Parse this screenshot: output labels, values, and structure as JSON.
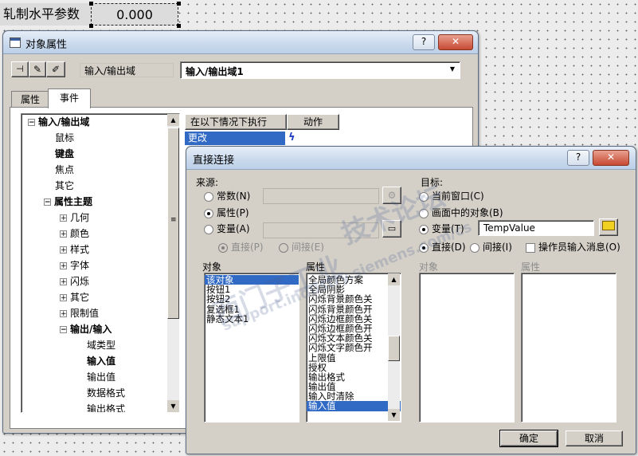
{
  "canvas": {
    "label": "轧制水平参数",
    "value": "0.000"
  },
  "props_window": {
    "title": "对象属性",
    "help": "?",
    "close": "✕",
    "toolbar_icons": [
      "pin-icon",
      "pipette-icon",
      "pipette-alt-icon"
    ],
    "object_type": "输入/输出域",
    "object_name": "输入/输出域1",
    "tabs": [
      "属性",
      "事件"
    ],
    "active_tab": "事件",
    "tree": [
      {
        "label": "输入/输出域",
        "bold": true,
        "level": 0,
        "expander": "−"
      },
      {
        "label": "鼠标",
        "bold": false,
        "level": 1,
        "expander": ""
      },
      {
        "label": "键盘",
        "bold": true,
        "level": 1,
        "expander": ""
      },
      {
        "label": "焦点",
        "bold": false,
        "level": 1,
        "expander": ""
      },
      {
        "label": "其它",
        "bold": false,
        "level": 1,
        "expander": ""
      },
      {
        "label": "属性主题",
        "bold": true,
        "level": 1,
        "expander": "−"
      },
      {
        "label": "几何",
        "bold": false,
        "level": 2,
        "expander": "+"
      },
      {
        "label": "颜色",
        "bold": false,
        "level": 2,
        "expander": "+"
      },
      {
        "label": "样式",
        "bold": false,
        "level": 2,
        "expander": "+"
      },
      {
        "label": "字体",
        "bold": false,
        "level": 2,
        "expander": "+"
      },
      {
        "label": "闪烁",
        "bold": false,
        "level": 2,
        "expander": "+"
      },
      {
        "label": "其它",
        "bold": false,
        "level": 2,
        "expander": "+"
      },
      {
        "label": "限制值",
        "bold": false,
        "level": 2,
        "expander": "+"
      },
      {
        "label": "输出/输入",
        "bold": true,
        "level": 2,
        "expander": "−"
      },
      {
        "label": "域类型",
        "bold": false,
        "level": 3,
        "expander": ""
      },
      {
        "label": "输入值",
        "bold": true,
        "level": 3,
        "expander": ""
      },
      {
        "label": "输出值",
        "bold": false,
        "level": 3,
        "expander": ""
      },
      {
        "label": "数据格式",
        "bold": false,
        "level": 3,
        "expander": ""
      },
      {
        "label": "输出格式",
        "bold": false,
        "level": 3,
        "expander": ""
      }
    ],
    "events_table": {
      "col1": "在以下情况下执行",
      "col2": "动作",
      "row_event": "更改",
      "row_action_icon": "lightning-icon"
    }
  },
  "direct_dialog": {
    "title": "直接连接",
    "help": "?",
    "close": "✕",
    "source_label": "来源:",
    "source_options": [
      {
        "label": "常数(N)",
        "checked": false
      },
      {
        "label": "属性(P)",
        "checked": true
      },
      {
        "label": "变量(A)",
        "checked": false
      }
    ],
    "source_sub": [
      {
        "label": "直接(P)",
        "checked": true
      },
      {
        "label": "间接(E)",
        "checked": false
      }
    ],
    "object_header": "对象",
    "object_list": [
      "该对象",
      "按钮1",
      "按钮2",
      "复选框1",
      "静态文本1"
    ],
    "object_selected": 0,
    "property_header": "属性",
    "property_list": [
      "全局颜色方案",
      "全局阴影",
      "闪烁背景颜色关",
      "闪烁背景颜色开",
      "闪烁边框颜色关",
      "闪烁边框颜色开",
      "闪烁文本颜色关",
      "闪烁文字颜色开",
      "上限值",
      "授权",
      "输出格式",
      "输出值",
      "输入时清除",
      "输入值"
    ],
    "property_selected": 13,
    "target_label": "目标:",
    "target_options": [
      {
        "label": "当前窗口(C)",
        "checked": false
      },
      {
        "label": "画面中的对象(B)",
        "checked": false
      },
      {
        "label": "变量(T)",
        "checked": true
      }
    ],
    "target_variable": "TempValue",
    "target_sub": [
      {
        "label": "直接(D)",
        "checked": true
      },
      {
        "label": "间接(I)",
        "checked": false
      }
    ],
    "operator_msg": "操作员输入消息(O)",
    "target_object_header": "对象",
    "target_property_header": "属性",
    "ok": "确定",
    "cancel": "取消"
  },
  "watermark": [
    "西门子工业",
    "技术论坛",
    "support.industry.siemens.com/cs"
  ]
}
